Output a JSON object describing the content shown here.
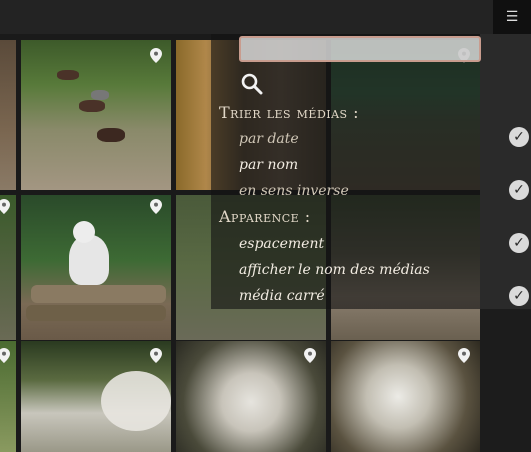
{
  "header": {
    "menu_icon": "☰"
  },
  "search": {
    "value": "",
    "placeholder": ""
  },
  "sort": {
    "title": "Trier les médias :",
    "options": [
      {
        "label": "par date",
        "active": false
      },
      {
        "label": "par nom",
        "active": true
      },
      {
        "label": "en sens inverse",
        "active": false
      }
    ]
  },
  "appearance": {
    "title": "Apparence :",
    "options": [
      {
        "label": "espacement",
        "active": true
      },
      {
        "label": "afficher le nom des médias",
        "active": true
      },
      {
        "label": "média carré",
        "active": true
      }
    ]
  },
  "checks": [
    "✓",
    "✓",
    "✓",
    "✓"
  ],
  "colors": {
    "overlay": "#141414",
    "check": "#dadada",
    "search_border": "#c89c8e"
  },
  "icons": [
    "menu-icon",
    "search-icon",
    "location-pin-icon",
    "checkmark-icon"
  ]
}
